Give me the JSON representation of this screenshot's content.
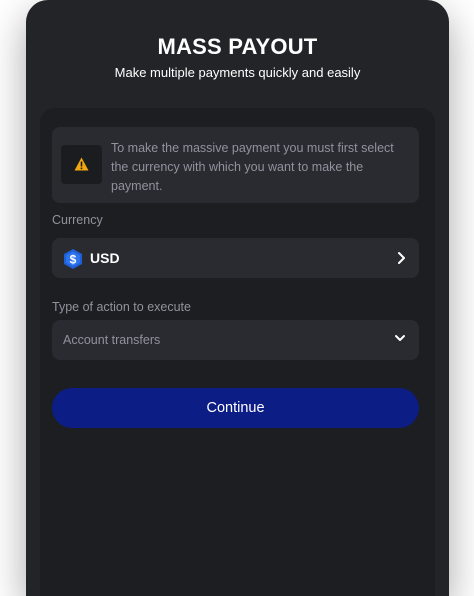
{
  "header": {
    "title": "MASS PAYOUT",
    "subtitle": "Make multiple payments quickly and easily"
  },
  "alert": {
    "icon": "warning-icon",
    "message": "To make the massive payment you must first select the currency with which you want to make the payment."
  },
  "currency": {
    "label": "Currency",
    "value": "USD",
    "icon": "dollar-coin-icon"
  },
  "action": {
    "label": "Type of action to execute",
    "value": "Account transfers"
  },
  "continue_label": "Continue",
  "colors": {
    "background": "#232428",
    "card": "#1d1e22",
    "field": "#2a2b31",
    "primary_button": "#0c1d86",
    "warning": "#f2a60f",
    "coin": "#1e5fd8"
  }
}
